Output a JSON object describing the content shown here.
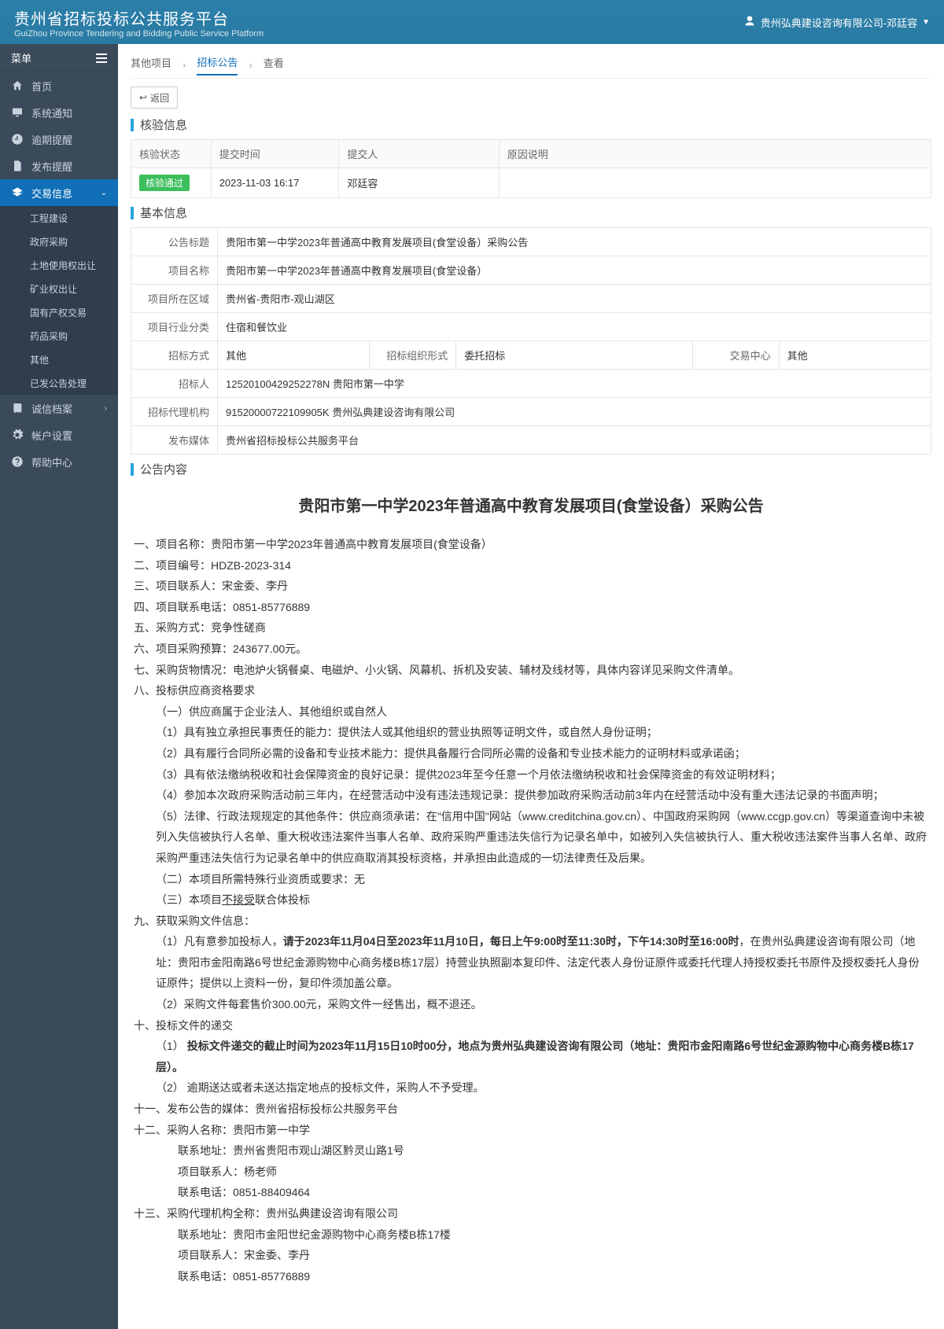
{
  "header": {
    "title_cn": "贵州省招标投标公共服务平台",
    "title_en": "GuiZhou Province Tendering and Bidding Public Service Platform",
    "user_label": "贵州弘典建设咨询有限公司-邓廷容"
  },
  "sidebar": {
    "menu_label": "菜单",
    "items": [
      {
        "label": "首页",
        "icon": "home"
      },
      {
        "label": "系统通知",
        "icon": "monitor"
      },
      {
        "label": "逾期提醒",
        "icon": "clock"
      },
      {
        "label": "发布提醒",
        "icon": "doc"
      },
      {
        "label": "交易信息",
        "icon": "layers",
        "active": true,
        "children": [
          {
            "label": "工程建设"
          },
          {
            "label": "政府采购"
          },
          {
            "label": "土地使用权出让"
          },
          {
            "label": "矿业权出让"
          },
          {
            "label": "国有产权交易"
          },
          {
            "label": "药品采购"
          },
          {
            "label": "其他"
          },
          {
            "label": "已发公告处理"
          }
        ]
      },
      {
        "label": "诚信档案",
        "icon": "book",
        "chev": true
      },
      {
        "label": "帐户设置",
        "icon": "gear"
      },
      {
        "label": "帮助中心",
        "icon": "help"
      }
    ]
  },
  "crumbs": [
    "其他项目",
    "招标公告",
    "查看"
  ],
  "back_btn": "返回",
  "verify_panel": {
    "title": "核验信息",
    "headers": [
      "核验状态",
      "提交时间",
      "提交人",
      "原因说明"
    ],
    "row": {
      "status": "核验通过",
      "time": "2023-11-03 16:17",
      "person": "邓廷容",
      "reason": ""
    }
  },
  "basic_panel": {
    "title": "基本信息",
    "rows": [
      {
        "k": "公告标题",
        "v": "贵阳市第一中学2023年普通高中教育发展项目(食堂设备）采购公告"
      },
      {
        "k": "项目名称",
        "v": "贵阳市第一中学2023年普通高中教育发展项目(食堂设备）"
      },
      {
        "k": "项目所在区域",
        "v": "贵州省-贵阳市-观山湖区"
      },
      {
        "k": "项目行业分类",
        "v": "住宿和餐饮业"
      }
    ],
    "triple": [
      {
        "k": "招标方式",
        "v": "其他"
      },
      {
        "k": "招标组织形式",
        "v": "委托招标"
      },
      {
        "k": "交易中心",
        "v": "其他"
      }
    ],
    "rows2": [
      {
        "k": "招标人",
        "v": "12520100429252278N 贵阳市第一中学"
      },
      {
        "k": "招标代理机构",
        "v": "91520000722109905K 贵州弘典建设咨询有限公司"
      },
      {
        "k": "发布媒体",
        "v": "贵州省招标投标公共服务平台"
      }
    ]
  },
  "content_panel": {
    "title": "公告内容",
    "doc_title": "贵阳市第一中学2023年普通高中教育发展项目(食堂设备）采购公告",
    "lines": [
      {
        "t": "一、项目名称：贵阳市第一中学2023年普通高中教育发展项目(食堂设备）"
      },
      {
        "t": "二、项目编号：HDZB-2023-314"
      },
      {
        "t": "三、项目联系人：宋金委、李丹"
      },
      {
        "t": "四、项目联系电话：0851-85776889"
      },
      {
        "t": "五、采购方式：竞争性磋商"
      },
      {
        "t": "六、项目采购预算：243677.00元。"
      },
      {
        "t": "七、采购货物情况：电池炉火锅餐桌、电磁炉、小火锅、风幕机、拆机及安装、辅材及线材等，具体内容详见采购文件清单。"
      },
      {
        "t": "八、投标供应商资格要求"
      },
      {
        "t": "（一）供应商属于企业法人、其他组织或自然人",
        "cls": "indent1"
      },
      {
        "t": "（1）具有独立承担民事责任的能力：提供法人或其他组织的营业执照等证明文件，或自然人身份证明；",
        "cls": "indent1"
      },
      {
        "t": "（2）具有履行合同所必需的设备和专业技术能力：提供具备履行合同所必需的设备和专业技术能力的证明材料或承诺函；",
        "cls": "indent1"
      },
      {
        "t": "（3）具有依法缴纳税收和社会保障资金的良好记录：提供2023年至今任意一个月依法缴纳税收和社会保障资金的有效证明材料；",
        "cls": "indent1"
      },
      {
        "t": "（4）参加本次政府采购活动前三年内，在经营活动中没有违法违规记录：提供参加政府采购活动前3年内在经营活动中没有重大违法记录的书面声明；",
        "cls": "indent1"
      },
      {
        "t": "（5）法律、行政法规规定的其他条件：供应商须承诺：在\"信用中国\"网站（www.creditchina.gov.cn）、中国政府采购网（www.ccgp.gov.cn）等渠道查询中未被列入失信被执行人名单、重大税收违法案件当事人名单、政府采购严重违法失信行为记录名单中，如被列入失信被执行人、重大税收违法案件当事人名单、政府采购严重违法失信行为记录名单中的供应商取消其投标资格，并承担由此造成的一切法律责任及后果。",
        "cls": "indent1"
      },
      {
        "t": "（二）本项目所需特殊行业资质或要求：无",
        "cls": "indent1"
      },
      {
        "html": "（三）本项目<u>不接受</u>联合体投标",
        "cls": "indent1"
      },
      {
        "t": "九、获取采购文件信息："
      },
      {
        "html": "（1）凡有意参加投标人，<b>请于2023年11月04日至2023年11月10日，每日上午9:00时至11:30时，下午14:30时至16:00时</b>，在贵州弘典建设咨询有限公司（地址：贵阳市金阳南路6号世纪金源购物中心商务楼B栋17层）持营业执照副本复印件、法定代表人身份证原件或委托代理人持授权委托书原件及授权委托人身份证原件；提供以上资料一份，复印件须加盖公章。",
        "cls": "indent1"
      },
      {
        "t": "（2）采购文件每套售价300.00元，采购文件一经售出，概不退还。",
        "cls": "indent1"
      },
      {
        "t": "十、投标文件的递交"
      },
      {
        "html": "（1）&nbsp;<b>投标文件递交的截止时间为2023年11月15日10时00分，地点为贵州弘典建设咨询有限公司（地址：贵阳市金阳南路6号世纪金源购物中心商务楼B栋17层）。</b>",
        "cls": "indent1"
      },
      {
        "t": "（2） 逾期送达或者未送达指定地点的投标文件，采购人不予受理。",
        "cls": "indent1"
      },
      {
        "t": "十一、发布公告的媒体：贵州省招标投标公共服务平台"
      },
      {
        "t": "十二、采购人名称：贵阳市第一中学"
      },
      {
        "t": "联系地址：贵州省贵阳市观山湖区黔灵山路1号",
        "cls": "indent2"
      },
      {
        "t": "项目联系人：杨老师",
        "cls": "indent2"
      },
      {
        "t": "联系电话：0851-88409464",
        "cls": "indent2"
      },
      {
        "t": "十三、采购代理机构全称：贵州弘典建设咨询有限公司"
      },
      {
        "t": "联系地址：贵阳市金阳世纪金源购物中心商务楼B栋17楼",
        "cls": "indent2"
      },
      {
        "t": "项目联系人：宋金委、李丹",
        "cls": "indent2"
      },
      {
        "t": "联系电话：0851-85776889",
        "cls": "indent2"
      }
    ]
  }
}
